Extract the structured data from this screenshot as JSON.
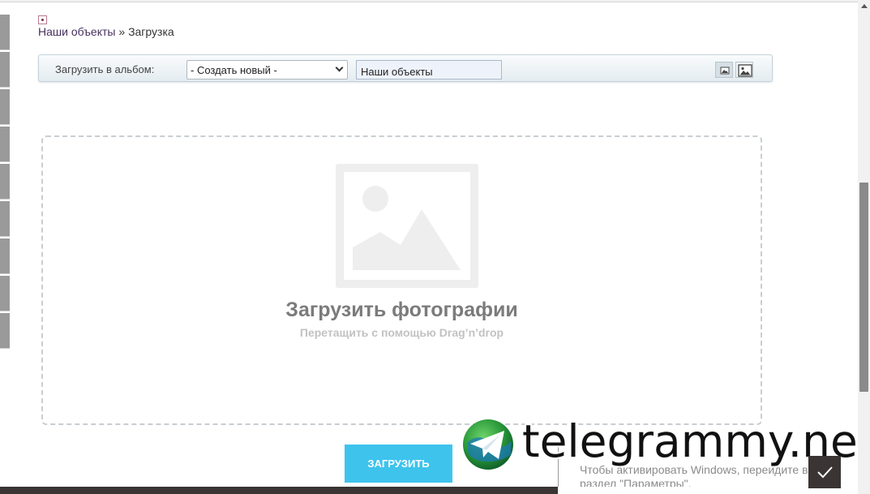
{
  "breadcrumb": {
    "parent": "Наши объекты",
    "separator": "»",
    "current": "Загрузка"
  },
  "toolbar": {
    "album_label": "Загрузить в альбом:",
    "album_select_value": "- Создать новый -",
    "album_name_value": "Наши объекты"
  },
  "dropzone": {
    "title": "Загрузить фотографии",
    "subtitle": "Перетащить с помощью Drag’n’drop"
  },
  "upload_button": "ЗАГРУЗИТЬ",
  "watermark": {
    "site": "telegrammy.net",
    "activate_line1": "Чтобы активировать Windows, перейдите в",
    "activate_line2": "раздел \"Параметры\"."
  },
  "icons": {
    "breadcrumb": "bullet-icon",
    "view_small": "image-small-icon",
    "view_large": "image-large-icon",
    "placeholder": "image-placeholder-icon",
    "telegram": "telegram-logo-icon",
    "check": "checkmark-icon"
  },
  "colors": {
    "upload_button": "#3ec3ed",
    "dropzone_title": "#7b7b7b",
    "dropzone_subtitle": "#c2c2c2",
    "breadcrumb_link": "#46305d"
  }
}
